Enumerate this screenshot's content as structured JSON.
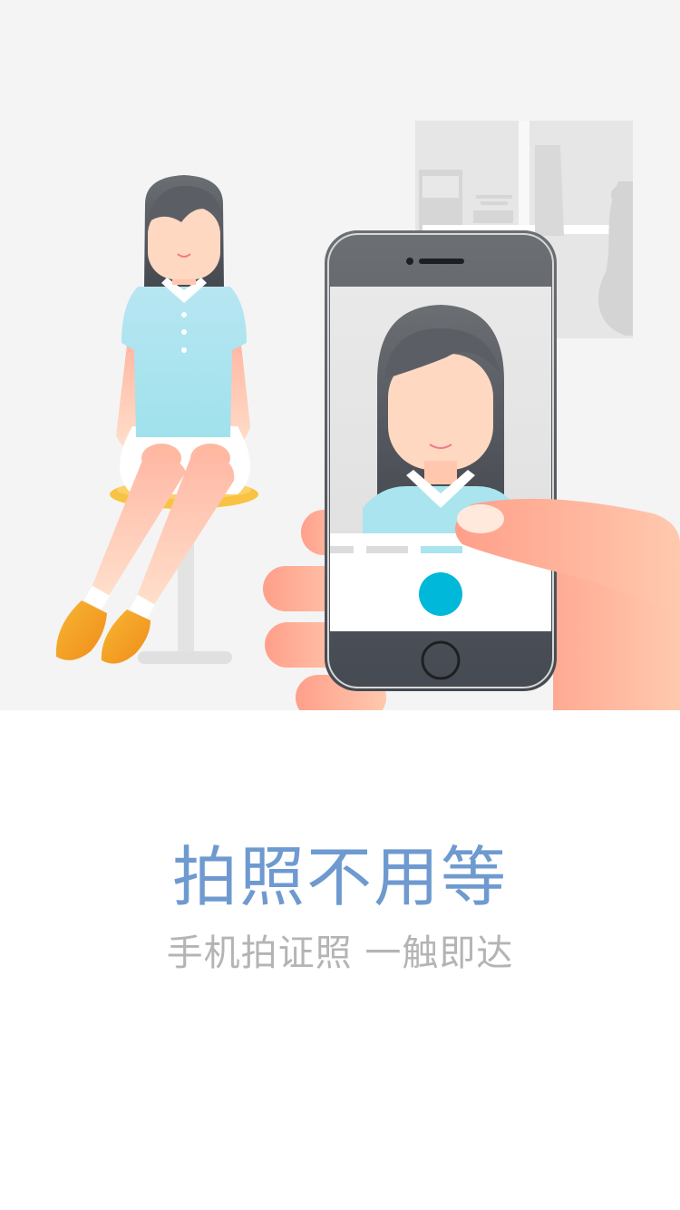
{
  "illustration": {
    "scene": "phone-photo-of-girl",
    "colors": {
      "background": "#f4f4f4",
      "shirt": "#a9e4ef",
      "hair": "#585b61",
      "skin": "#ffd2b8",
      "shoes": "#f5a623",
      "stool_seat": "#f8c342",
      "phone_body": "#4a4d53",
      "shutter": "#00b8d9",
      "hand": "#ffb59f"
    }
  },
  "onboarding": {
    "title": "拍照不用等",
    "subtitle": "手机拍证照 一触即达"
  }
}
